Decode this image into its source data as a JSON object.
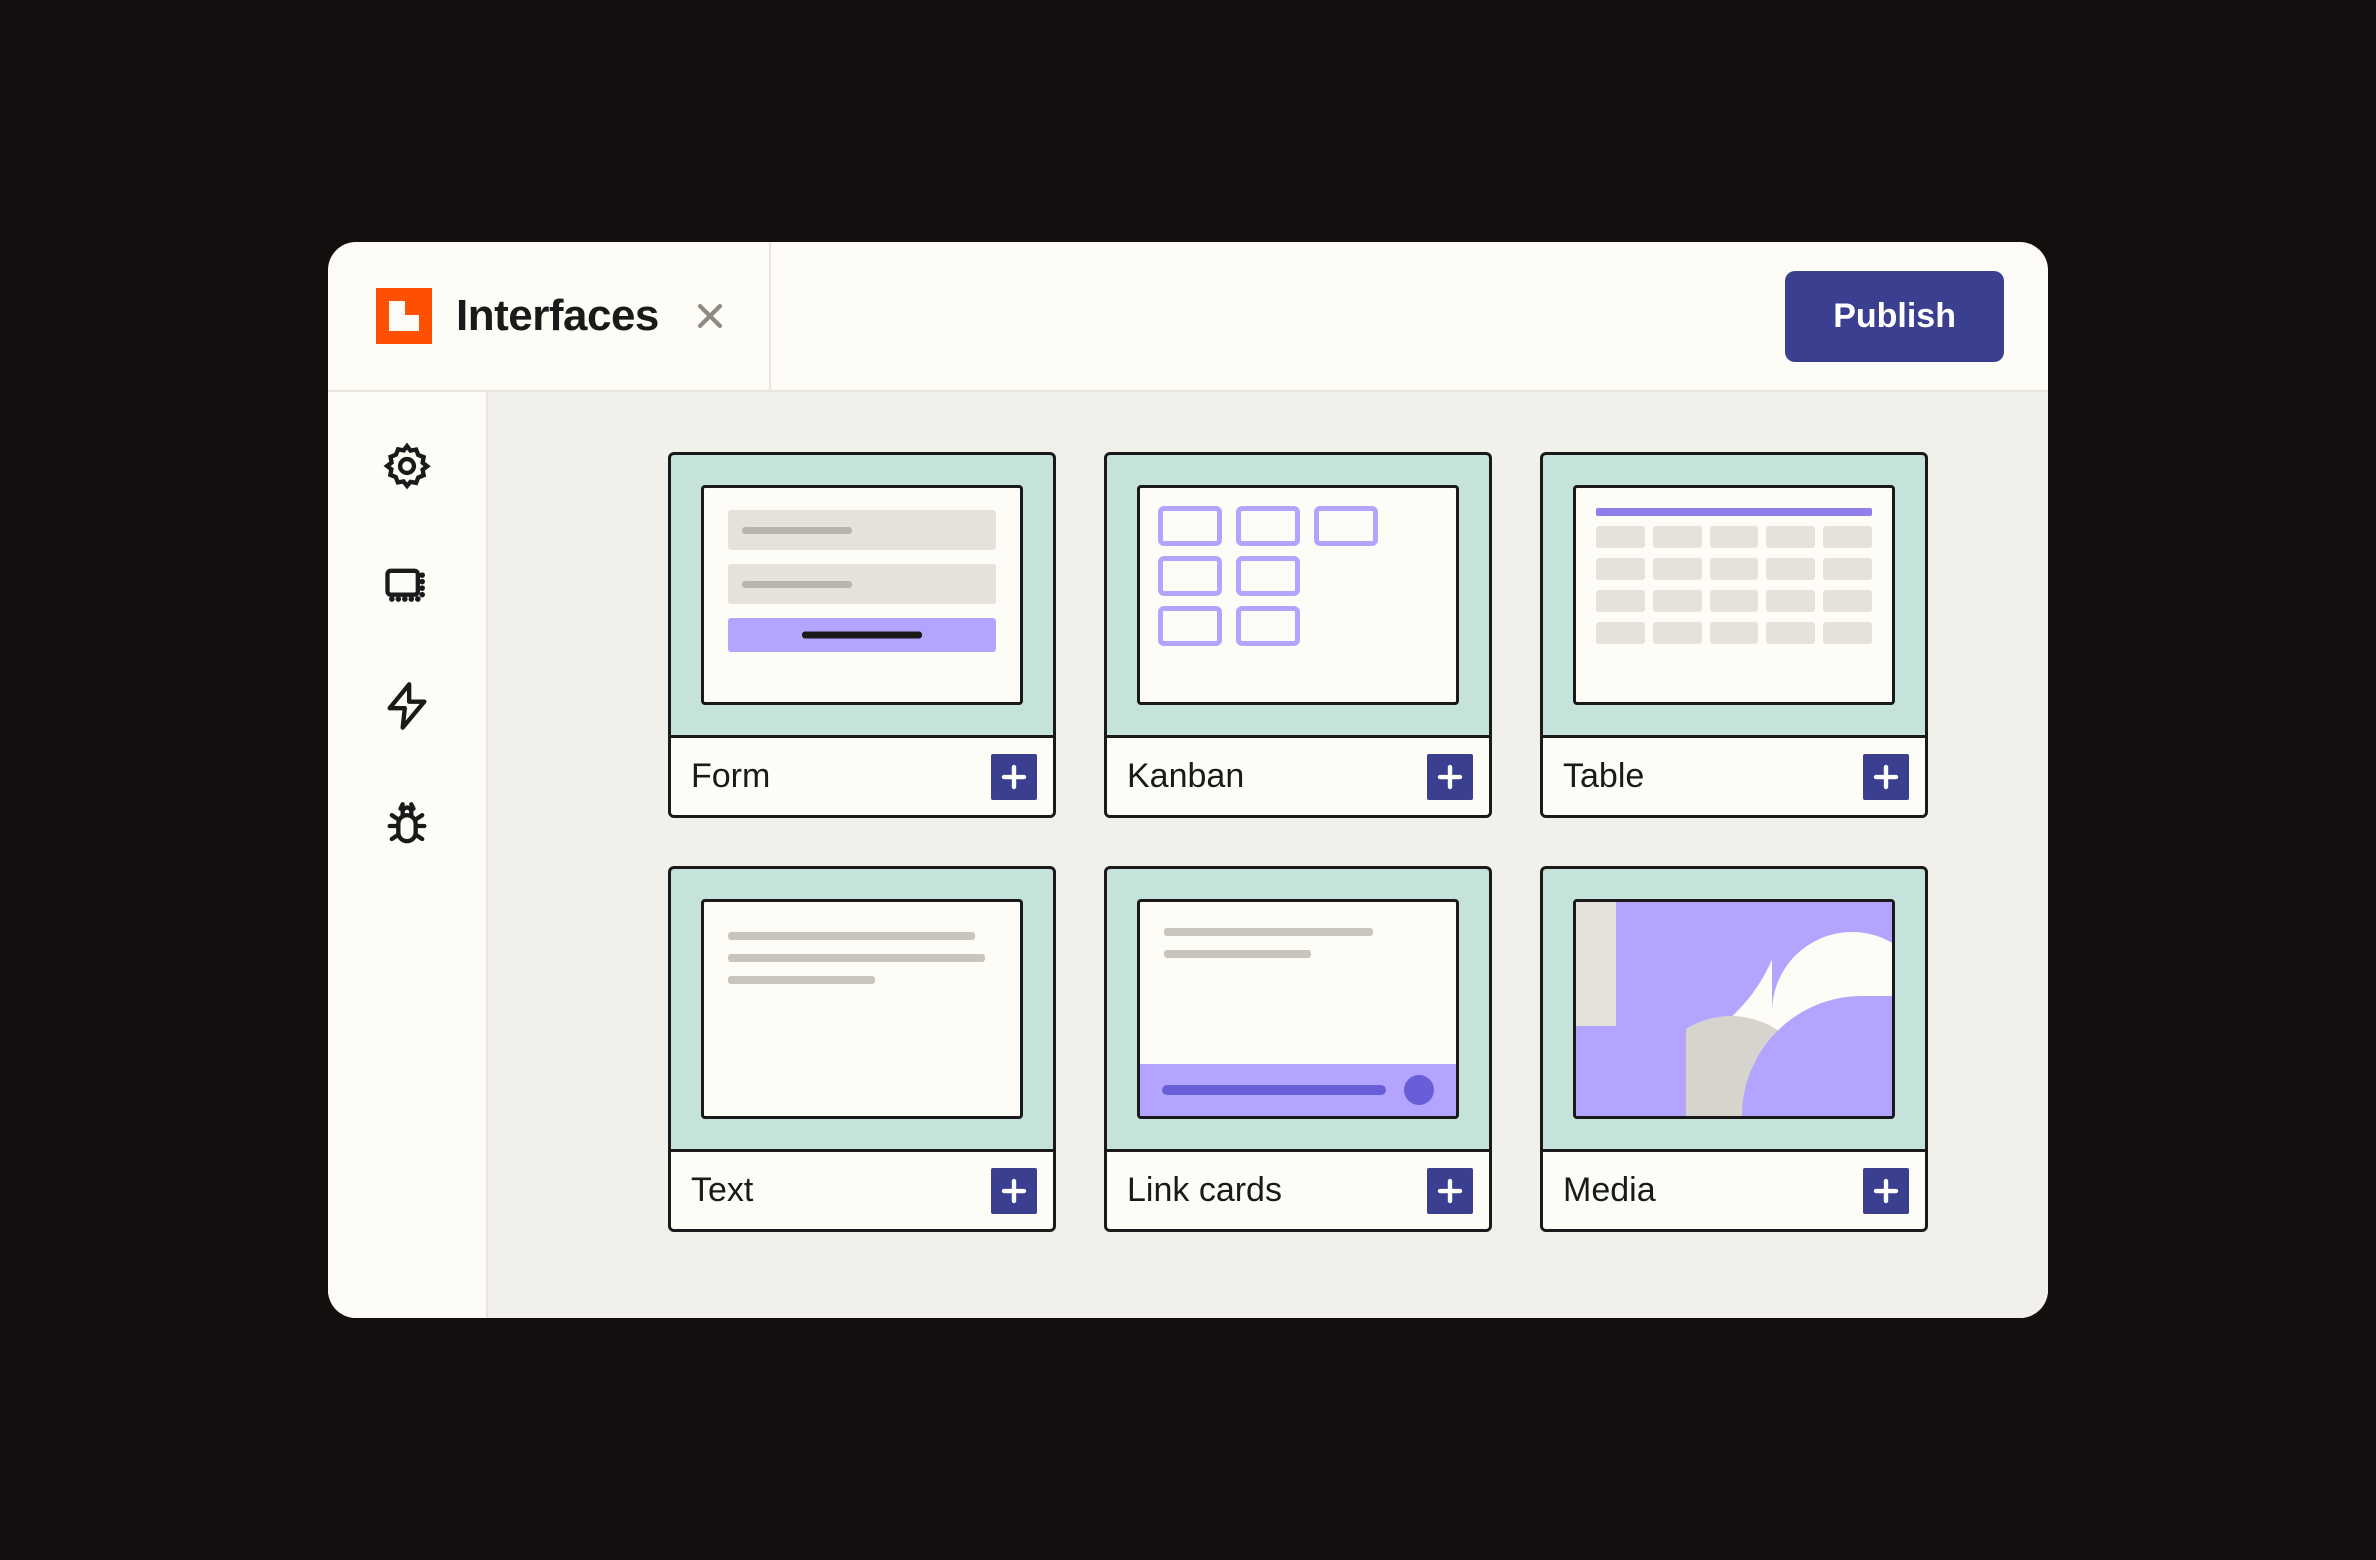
{
  "app": {
    "title": "Interfaces"
  },
  "actions": {
    "publish_label": "Publish"
  },
  "sidebar": {
    "items": [
      {
        "name": "settings"
      },
      {
        "name": "layout"
      },
      {
        "name": "automations"
      },
      {
        "name": "debug"
      }
    ]
  },
  "blocks": [
    {
      "id": "form",
      "label": "Form"
    },
    {
      "id": "kanban",
      "label": "Kanban"
    },
    {
      "id": "table",
      "label": "Table"
    },
    {
      "id": "text",
      "label": "Text"
    },
    {
      "id": "link",
      "label": "Link cards"
    },
    {
      "id": "media",
      "label": "Media"
    }
  ],
  "colors": {
    "brand_orange": "#ff4f00",
    "accent_indigo": "#3b3f8f",
    "accent_lilac": "#b3a5ff",
    "card_bg": "#c6e3db"
  }
}
